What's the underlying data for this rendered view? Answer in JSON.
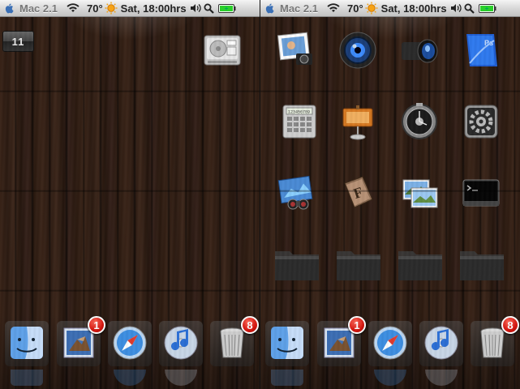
{
  "status": {
    "carrier": "Mac 2.1",
    "temperature": "70°",
    "datetime": "Sat, 18:00hrs"
  },
  "left_screen": {
    "clock_widget": "11",
    "dock": {
      "mail_badge": "1",
      "trash_badge": "8"
    }
  },
  "right_screen": {
    "dock": {
      "mail_badge": "1",
      "trash_badge": "8"
    }
  },
  "icons": {
    "left": [
      "hard-drive"
    ],
    "right_rows": [
      [
        "iphoto",
        "webcam",
        "camera-lens",
        "photoshop"
      ],
      [
        "calculator",
        "keynote",
        "dashboard-watch",
        "system-preferences"
      ],
      [
        "preview",
        "font-book",
        "image-capture",
        "terminal"
      ],
      [
        "folder",
        "folder",
        "folder",
        "folder"
      ]
    ],
    "dock": [
      "finder",
      "mail",
      "safari",
      "itunes",
      "trash"
    ]
  },
  "colors": {
    "wood": "#2e1c12",
    "statusbar": "#d6d6d6",
    "badge": "#d7140d"
  }
}
